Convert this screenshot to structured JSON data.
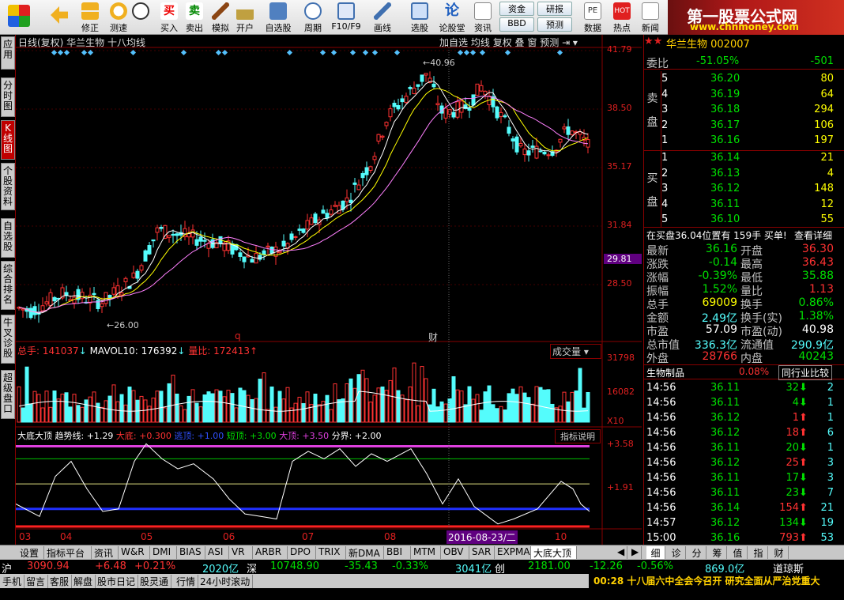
{
  "toolbar": {
    "buttons": [
      {
        "name": "back",
        "label": ""
      },
      {
        "name": "fix",
        "label": "修正"
      },
      {
        "name": "test",
        "label": "测速"
      },
      {
        "name": "buy",
        "label": "买入"
      },
      {
        "name": "sell",
        "label": "卖出"
      },
      {
        "name": "simulate",
        "label": "模拟"
      },
      {
        "name": "open",
        "label": "开户"
      },
      {
        "name": "watchlist",
        "label": "自选股"
      },
      {
        "name": "period",
        "label": "周期"
      },
      {
        "name": "f10",
        "label": "F10/F9"
      },
      {
        "name": "draw",
        "label": "画线"
      },
      {
        "name": "select",
        "label": "选股"
      },
      {
        "name": "forum",
        "label": "论股堂"
      },
      {
        "name": "info",
        "label": "资讯"
      },
      {
        "name": "data",
        "label": "数据"
      },
      {
        "name": "hot",
        "label": "热点"
      },
      {
        "name": "news",
        "label": "新闻"
      }
    ],
    "small": [
      "资金",
      "BBD",
      "研报",
      "预测"
    ],
    "brand_title": "第一股票公式网",
    "brand_url": "www.chnmoney.com"
  },
  "left_tabs": [
    "应用",
    "分时图",
    "K线图",
    "个股资料",
    "自选股",
    "综合排名",
    "牛叉诊股",
    "超级盘口"
  ],
  "chart": {
    "header": "日线(复权)  华兰生物  十八均线",
    "header_buttons": [
      "加自选",
      "均线",
      "复权",
      "叠",
      "窗",
      "预测"
    ],
    "price_high_label": "40.96",
    "price_low_label": "26.00",
    "price_axis": [
      "41.79",
      "38.50",
      "35.17",
      "31.84",
      "28.50"
    ],
    "current_price_tag": "29.81",
    "markers": [
      "q",
      "财"
    ],
    "volume_info": {
      "total": "总手: 141037",
      "mavol": "MAVOL10: 176392",
      "ratio": "量比: 172413"
    },
    "volume_axis": [
      "31798",
      "16082",
      "X10"
    ],
    "volume_dropdown": "成交量",
    "indicator_info": {
      "name": "大底大顶",
      "trend": "趋势线: +1.29",
      "bottom": "大底: +0.300",
      "escape": "逃顶: +1.00",
      "short": "短顶: +3.00",
      "top": "大顶: +3.50",
      "divide": "分界: +2.00"
    },
    "indicator_help": "指标说明",
    "indicator_axis": [
      "+3.58",
      "+1.91"
    ],
    "date_axis": [
      "03",
      "04",
      "05",
      "06",
      "07",
      "08",
      "10"
    ],
    "date_cursor": "2016-08-23/二"
  },
  "right_panel": {
    "header": "华兰生物 002007",
    "ratio_label": "委比",
    "ratio_pct": "-51.05%",
    "ratio_diff": "-501",
    "sell_label": "卖盘",
    "buy_label": "买盘",
    "sell": [
      [
        "5",
        "36.20",
        "80"
      ],
      [
        "4",
        "36.19",
        "64"
      ],
      [
        "3",
        "36.18",
        "294"
      ],
      [
        "2",
        "36.17",
        "106"
      ],
      [
        "1",
        "36.16",
        "197"
      ]
    ],
    "buy": [
      [
        "1",
        "36.14",
        "21"
      ],
      [
        "2",
        "36.13",
        "4"
      ],
      [
        "3",
        "36.12",
        "148"
      ],
      [
        "4",
        "36.11",
        "12"
      ],
      [
        "5",
        "36.10",
        "55"
      ]
    ],
    "notice": "在买盘36.04位置有 159手 买单!",
    "notice_link": "查看详细",
    "quote": [
      [
        "最新",
        "36.16",
        "开盘",
        "36.30"
      ],
      [
        "涨跌",
        "-0.14",
        "最高",
        "36.43"
      ],
      [
        "涨幅",
        "-0.39%",
        "最低",
        "35.88"
      ],
      [
        "振幅",
        "1.52%",
        "量比",
        "1.13"
      ],
      [
        "总手",
        "69009",
        "换手",
        "0.86%"
      ],
      [
        "金额",
        "2.49亿",
        "换手(实)",
        "1.38%"
      ],
      [
        "市盈",
        "57.09",
        "市盈(动)",
        "40.98"
      ],
      [
        "总市值",
        "336.3亿",
        "流通值",
        "290.9亿"
      ],
      [
        "外盘",
        "28766",
        "内盘",
        "40243"
      ]
    ],
    "sector": "生物制品",
    "sector_pct": "0.08%",
    "sector_btn": "同行业比较",
    "ticks": [
      [
        "14:56",
        "36.11",
        "32",
        "2"
      ],
      [
        "14:56",
        "36.11",
        "4",
        "1"
      ],
      [
        "14:56",
        "36.12",
        "1",
        "1"
      ],
      [
        "14:56",
        "36.12",
        "18",
        "6"
      ],
      [
        "14:56",
        "36.11",
        "20",
        "1"
      ],
      [
        "14:56",
        "36.12",
        "25",
        "3"
      ],
      [
        "14:56",
        "36.11",
        "17",
        "3"
      ],
      [
        "14:56",
        "36.11",
        "23",
        "7"
      ],
      [
        "14:56",
        "36.14",
        "154",
        "21"
      ],
      [
        "14:57",
        "36.12",
        "134",
        "19"
      ],
      [
        "15:00",
        "36.16",
        "793",
        "53"
      ]
    ],
    "tick_dirs": [
      "down",
      "down",
      "up",
      "up",
      "down",
      "up",
      "down",
      "down",
      "up",
      "down",
      "up"
    ]
  },
  "bottom_tabs": [
    "设置",
    "指标平台",
    "资讯",
    "W&R",
    "DMI",
    "BIAS",
    "ASI",
    "VR",
    "ARBR",
    "DPO",
    "TRIX",
    "新DMA",
    "BBI",
    "MTM",
    "OBV",
    "SAR",
    "EXPMA",
    "大底大顶"
  ],
  "right_tabs": [
    "细",
    "诊",
    "分",
    "筹",
    "值",
    "指",
    "财"
  ],
  "index_bar": {
    "sh_label": "沪",
    "sh_value": "3090.94",
    "sh_change": "+6.48",
    "sh_pct": "+0.21%",
    "sh_amount": "2020亿",
    "sz_label": "深",
    "sz_value": "10748.90",
    "sz_change": "-35.43",
    "sz_pct": "-0.33%",
    "sz_amount": "3041亿",
    "cy_label": "创",
    "cy_value": "2181.00",
    "cy_change": "-12.26",
    "cy_pct": "-0.56%",
    "cy_amount": "869.0亿",
    "dj_label": "道琼斯"
  },
  "status_bar": [
    "手机",
    "留言",
    "客服",
    "解盘",
    "股市日记",
    "股灵通",
    "行情",
    "24小时滚动"
  ],
  "ticker": "00:28 十八届六中全会今召开 研究全面从严治党重大"
}
